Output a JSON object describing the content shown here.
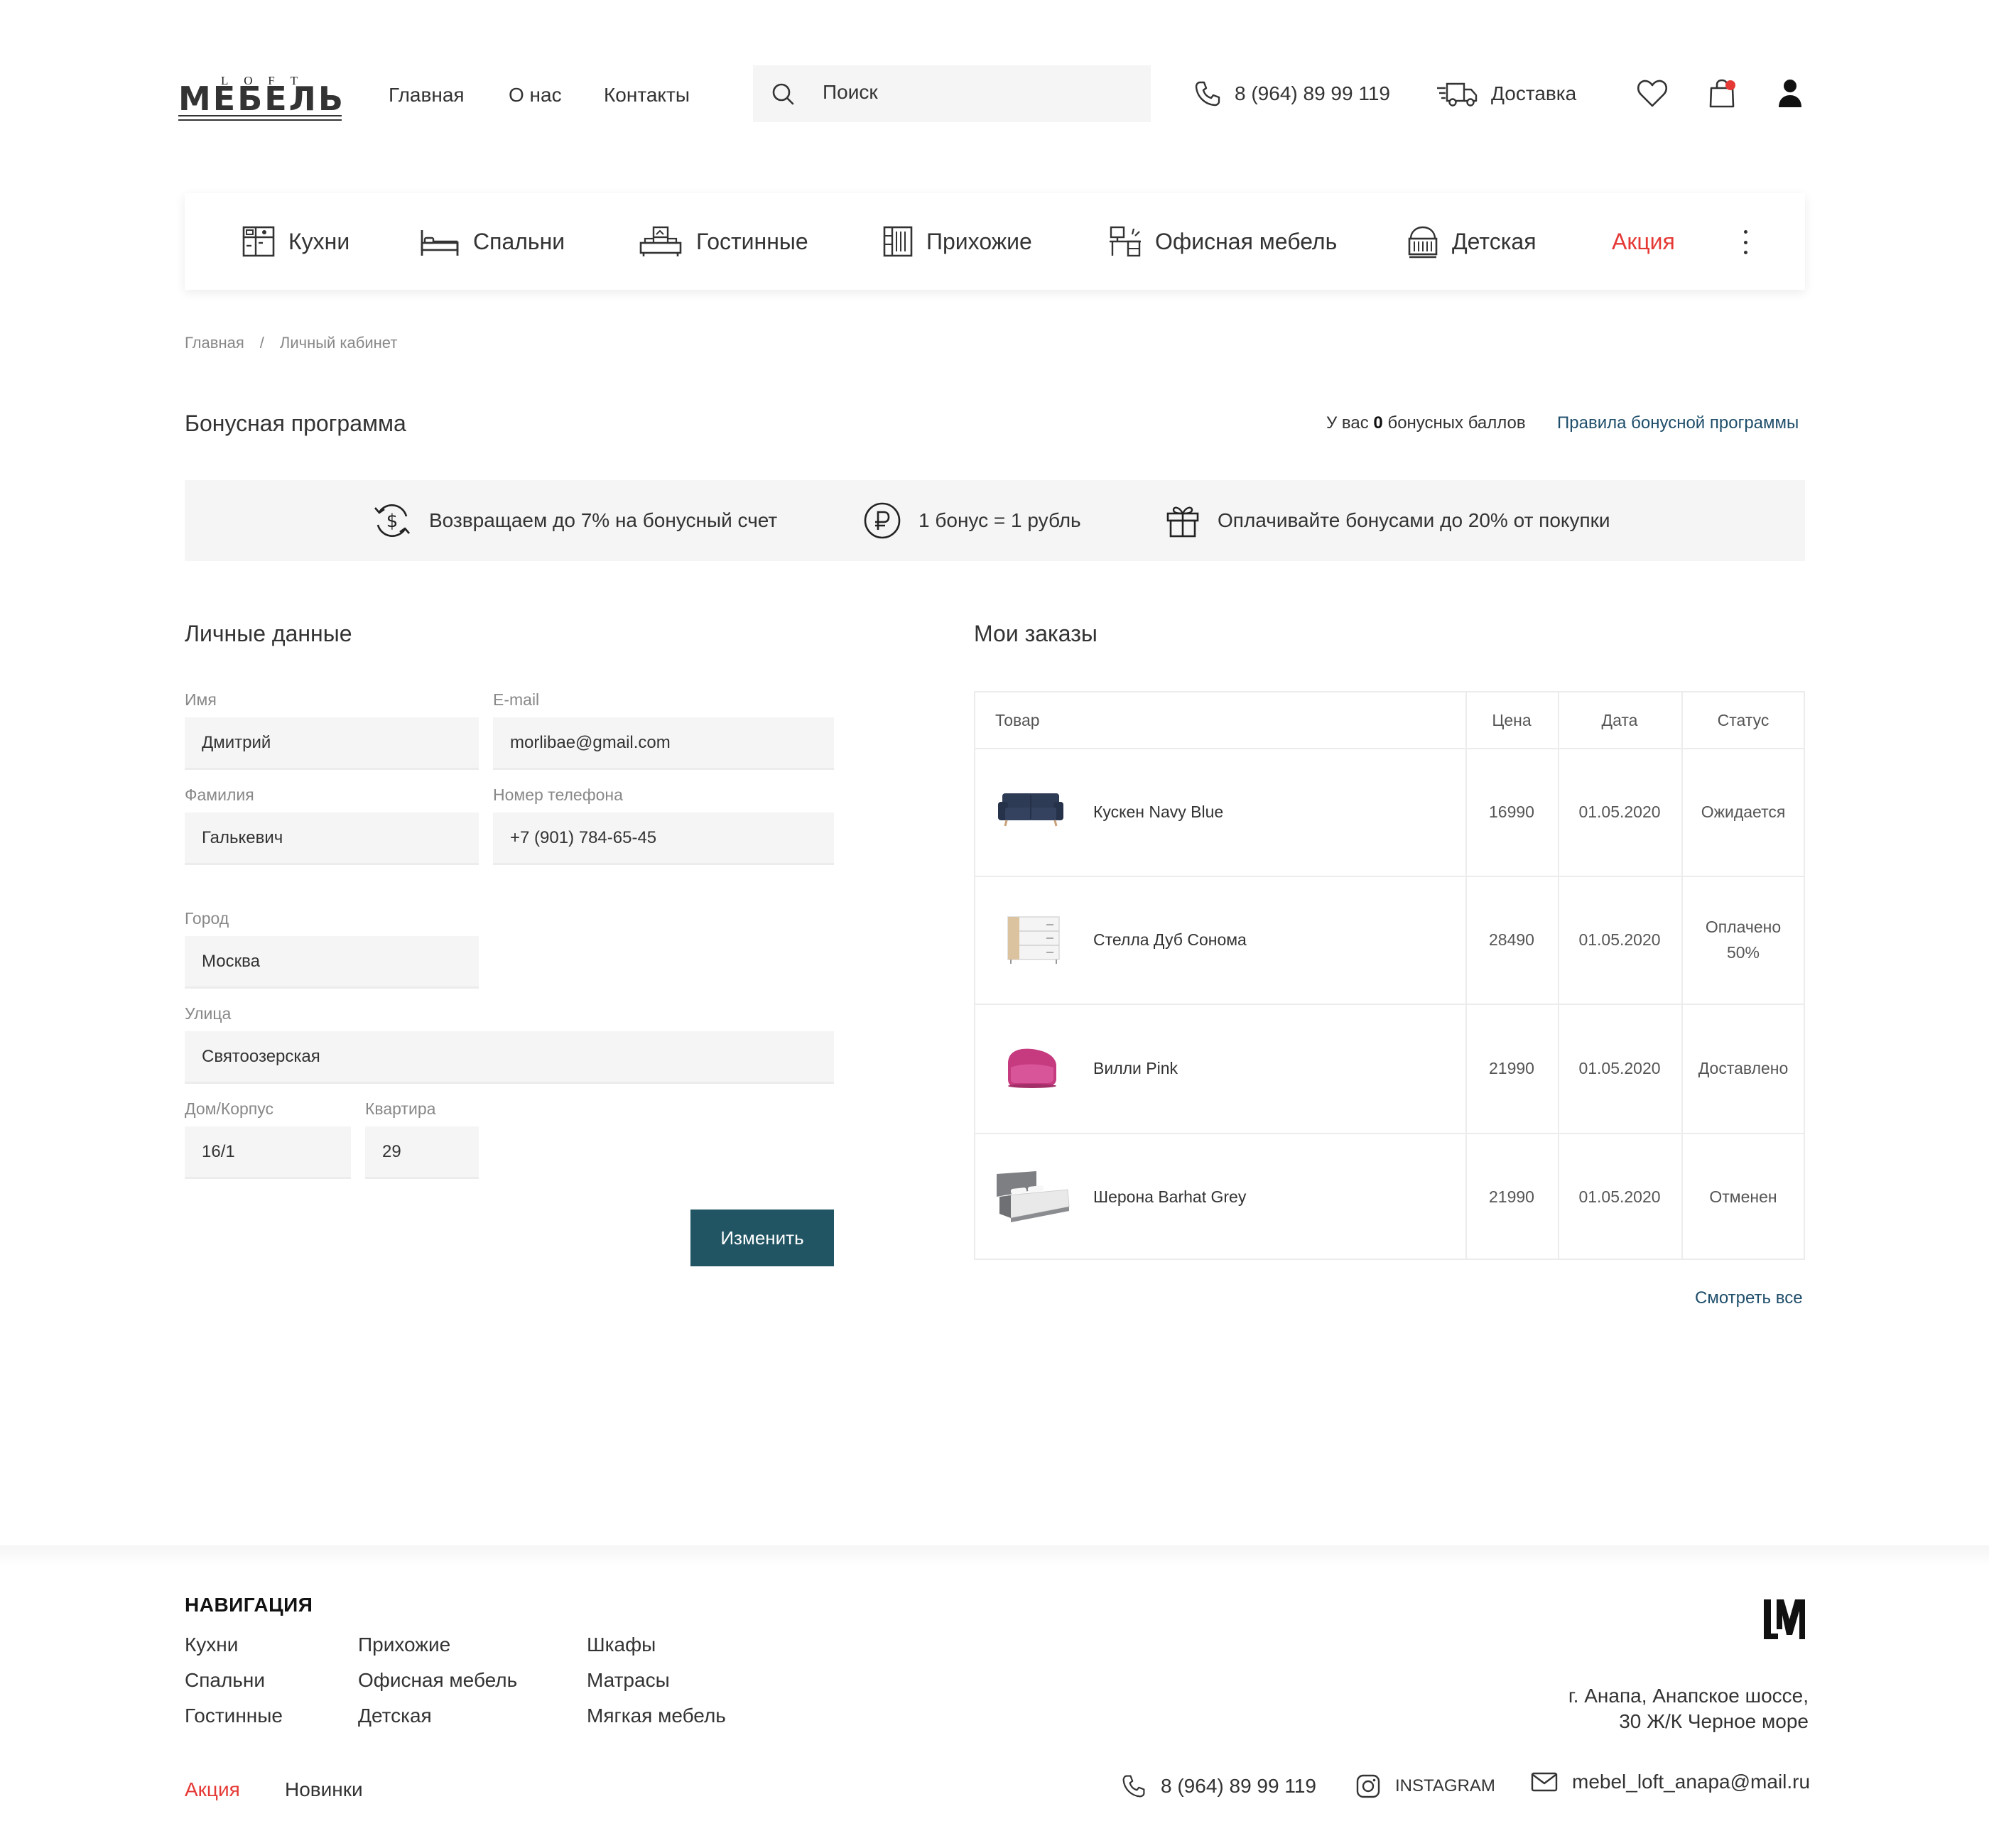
{
  "header": {
    "logo": {
      "top": "LOFT",
      "main": "МЕБЕЛЬ"
    },
    "nav": [
      "Главная",
      "О нас",
      "Контакты"
    ],
    "search_placeholder": "Поиск",
    "phone": "8 (964) 89 99 119",
    "delivery": "Доставка",
    "cart_badge_color": "#e53935"
  },
  "categories": [
    {
      "label": "Кухни",
      "icon": "kitchen-icon"
    },
    {
      "label": "Спальни",
      "icon": "bed-icon"
    },
    {
      "label": "Гостинные",
      "icon": "living-room-icon"
    },
    {
      "label": "Прихожие",
      "icon": "hallway-icon"
    },
    {
      "label": "Офисная мебель",
      "icon": "office-icon"
    },
    {
      "label": "Детская",
      "icon": "crib-icon"
    },
    {
      "label": "Акция",
      "icon": null,
      "highlight": "#e53935"
    }
  ],
  "breadcrumbs": {
    "home": "Главная",
    "sep": "/",
    "current": "Личный кабинет"
  },
  "bonus": {
    "title": "Бонусная программа",
    "count_prefix": "У вас",
    "count": "0",
    "count_suffix": "бонусных баллов",
    "rules_link": "Правила бонусной программы",
    "perks": [
      {
        "text": "Возвращаем до 7% на бонусный счет",
        "icon": "cashback-icon"
      },
      {
        "text": "1 бонус = 1 рубль",
        "icon": "ruble-icon"
      },
      {
        "text": "Оплачивайте бонусами до 20% от покупки",
        "icon": "gift-icon"
      }
    ]
  },
  "personal": {
    "title": "Личные данные",
    "fields": {
      "first_name": {
        "label": "Имя",
        "value": "Дмитрий"
      },
      "email": {
        "label": "E-mail",
        "value": "morlibae@gmail.com"
      },
      "last_name": {
        "label": "Фамилия",
        "value": "Галькевич"
      },
      "phone": {
        "label": "Номер телефона",
        "value": "+7 (901) 784-65-45"
      },
      "city": {
        "label": "Город",
        "value": "Москва"
      },
      "street": {
        "label": "Улица",
        "value": "Святоозерская"
      },
      "house": {
        "label": "Дом/Корпус",
        "value": "16/1"
      },
      "apartment": {
        "label": "Квартира",
        "value": "29"
      }
    },
    "submit": "Изменить"
  },
  "orders": {
    "title": "Мои заказы",
    "columns": [
      "Товар",
      "Цена",
      "Дата",
      "Статус"
    ],
    "rows": [
      {
        "product": "Кускен Navy Blue",
        "price": "16990",
        "date": "01.05.2020",
        "status": "Ожидается",
        "thumb": "sofa-thumbnail"
      },
      {
        "product": "Стелла Дуб Сонома",
        "price": "28490",
        "date": "01.05.2020",
        "status": "Оплачено 50%",
        "thumb": "dresser-thumbnail"
      },
      {
        "product": "Вилли Pink",
        "price": "21990",
        "date": "01.05.2020",
        "status": "Доставлено",
        "thumb": "armchair-thumbnail"
      },
      {
        "product": "Шерона Barhat Grey",
        "price": "21990",
        "date": "01.05.2020",
        "status": "Отменен",
        "thumb": "bed-thumbnail"
      }
    ],
    "view_all": "Смотреть все"
  },
  "footer": {
    "nav_title": "НАВИГАЦИЯ",
    "col1": [
      "Кухни",
      "Спальни",
      "Гостинные"
    ],
    "col2": [
      "Прихожие",
      "Офисная мебель",
      "Детская"
    ],
    "col3": [
      "Шкафы",
      "Матрасы",
      "Мягкая мебель"
    ],
    "sale": "Акция",
    "new": "Новинки",
    "address_line1": "г. Анапа, Анапское шоссе,",
    "address_line2": "30 Ж/К Черное море",
    "phone": "8 (964) 89 99 119",
    "instagram": "INSTAGRAM",
    "email": "mebel_loft_anapa@mail.ru",
    "logo": "LM"
  }
}
